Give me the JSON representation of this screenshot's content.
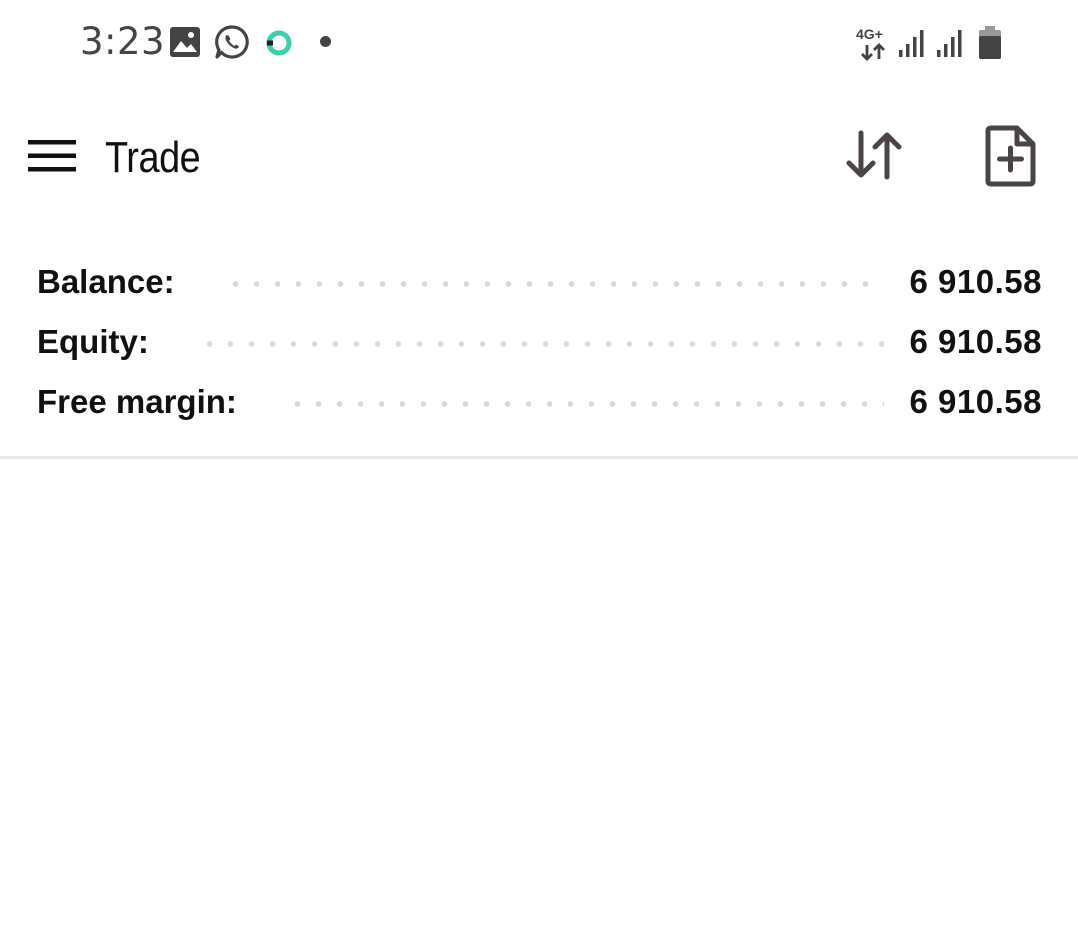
{
  "status_bar": {
    "time": "3:23",
    "network": "4G+",
    "icons": [
      "gallery-icon",
      "whatsapp-icon",
      "sync-ring-icon",
      "notification-dot-icon",
      "network-4g-icon",
      "signal-icon",
      "signal-icon",
      "battery-icon"
    ]
  },
  "app_bar": {
    "title": "Trade",
    "menu_icon": "hamburger-menu-icon",
    "sort_icon": "sort-arrows-icon",
    "new_order_icon": "file-plus-icon"
  },
  "summary": {
    "rows": [
      {
        "label": "Balance:",
        "value": "6 910.58"
      },
      {
        "label": "Equity:",
        "value": "6 910.58"
      },
      {
        "label": "Free margin:",
        "value": "6 910.58"
      }
    ]
  },
  "colors": {
    "text": "#111111",
    "icon_gray": "#4a4444",
    "status_gray": "#444444",
    "accent_teal": "#3ecfae",
    "leader_dots": "#d9d9d9",
    "divider": "#e6e6e6"
  }
}
